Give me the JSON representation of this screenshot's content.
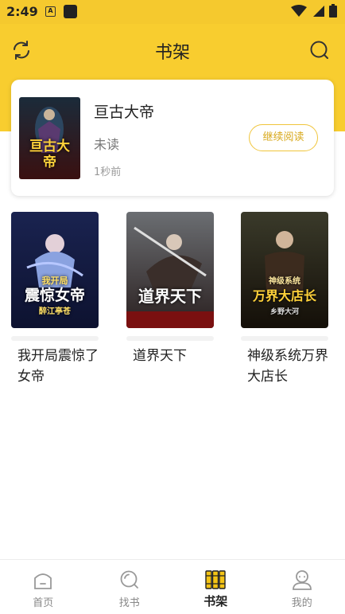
{
  "status_bar": {
    "time": "2:49",
    "notif_letter": "A"
  },
  "header": {
    "title": "书架"
  },
  "recent": {
    "title": "亘古大帝",
    "status": "未读",
    "time": "1秒前",
    "continue_label": "继续阅读",
    "cover_text": "亘古大帝"
  },
  "books": [
    {
      "title": "我开局震惊了女帝",
      "cover_small": "我开局",
      "cover_main": "震惊女帝",
      "cover_author": "醉江亭苍"
    },
    {
      "title": "道界天下",
      "cover_main": "道界天下"
    },
    {
      "title": "神级系统万界大店长",
      "cover_small": "神级系统",
      "cover_main": "万界大店长",
      "cover_author": "乡野大河"
    }
  ],
  "tabs": [
    {
      "label": "首页",
      "icon": "home-icon"
    },
    {
      "label": "找书",
      "icon": "search-icon"
    },
    {
      "label": "书架",
      "icon": "bookshelf-icon",
      "active": true
    },
    {
      "label": "我的",
      "icon": "profile-icon"
    }
  ],
  "colors": {
    "accent": "#f8cd2f",
    "button_border": "#f0c53b",
    "button_text": "#d8a91c"
  }
}
